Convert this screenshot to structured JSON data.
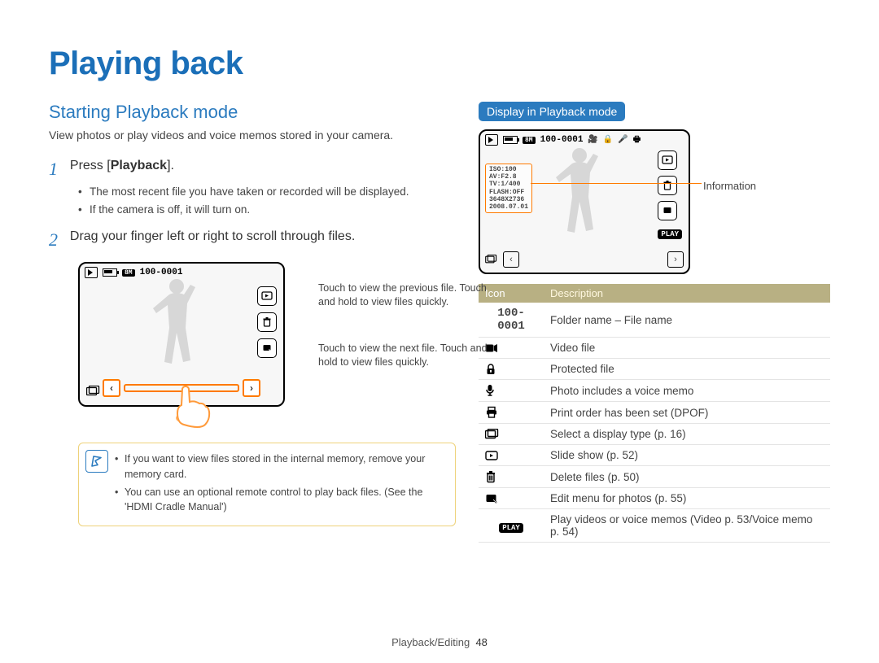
{
  "page": {
    "title": "Playing back",
    "footer_section": "Playback/Editing",
    "footer_page": "48"
  },
  "left": {
    "section_title": "Starting Playback mode",
    "section_desc": "View photos or play videos and voice memos stored in your camera.",
    "steps": {
      "s1": {
        "num": "1",
        "prefix": "Press [",
        "bold": "Playback",
        "suffix": "].",
        "bullets": {
          "b1": "The most recent file you have taken or recorded will be displayed.",
          "b2": "If the camera is off, it will turn on."
        }
      },
      "s2": {
        "num": "2",
        "text": "Drag your finger left or right to scroll through files."
      }
    },
    "lcd": {
      "badge": "8M",
      "file_label": "100-0001"
    },
    "lcd_callouts": {
      "prev": "Touch to view the previous file. Touch and hold to view files quickly.",
      "next": "Touch to view the next file. Touch and hold to view files quickly."
    },
    "note": {
      "n1": "If you want to view files stored in the internal memory, remove your memory card.",
      "n2": "You can use an optional remote control to play back files. (See the 'HDMI Cradle Manual')"
    }
  },
  "right": {
    "subhead": "Display in Playback mode",
    "lcd2": {
      "badge": "8M",
      "file_label": "100-0001",
      "info_lines": {
        "l1": "ISO:100",
        "l2": "AV:F2.8",
        "l3": "TV:1/400",
        "l4": "FLASH:OFF",
        "l5": "3648X2736",
        "l6": "2008.07.01"
      }
    },
    "info_callout": "Information",
    "table": {
      "head_icon": "Icon",
      "head_desc": "Description",
      "rows": {
        "r0_icon": "100-0001",
        "r0_desc": "Folder name – File name",
        "r1_desc": "Video file",
        "r2_desc": "Protected file",
        "r3_desc": "Photo includes a voice memo",
        "r4_desc": "Print order has been set (DPOF)",
        "r5_desc": "Select a display type (p. 16)",
        "r6_desc": "Slide show (p. 52)",
        "r7_desc": "Delete files (p. 50)",
        "r8_desc": "Edit menu for photos (p. 55)",
        "r9_icon": "PLAY",
        "r9_desc": "Play videos or voice memos (Video p. 53/Voice memo p. 54)"
      }
    }
  }
}
